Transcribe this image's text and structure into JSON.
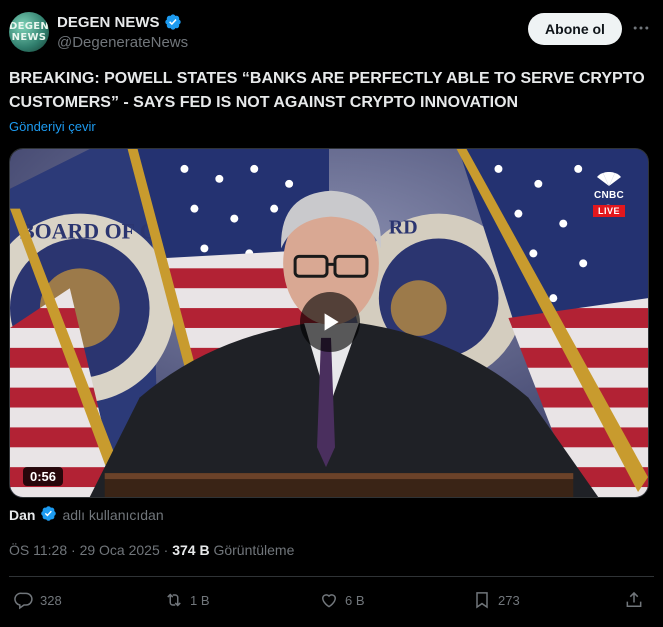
{
  "account": {
    "avatar_text": "DEGEN NEWS",
    "name": "DEGEN NEWS",
    "handle": "@DegenerateNews",
    "verified": true
  },
  "header": {
    "follow_label": "Abone ol",
    "more_icon": "more-horizontal-icon"
  },
  "tweet": {
    "text": "BREAKING: POWELL STATES “BANKS ARE PERFECTLY ABLE TO SERVE CRYPTO CUSTOMERS” - SAYS FED IS NOT AGAINST CRYPTO INNOVATION",
    "translate_label": "Gönderiyi çevir"
  },
  "media": {
    "duration": "0:56",
    "channel_logo_text": "CNBC",
    "live_badge": "LIVE",
    "seal_text_left": "BOARD OF GOVERNORS",
    "seal_text_right": "RD OF GOVE"
  },
  "source": {
    "name": "Dan",
    "suffix": "adlı kullanıcıdan"
  },
  "meta": {
    "time": "ÖS 11:28",
    "separator": " · ",
    "date": "29 Oca 2025",
    "views_count": "374 B",
    "views_label": "Görüntüleme"
  },
  "actions": {
    "replies": "328",
    "reposts": "1 B",
    "likes": "6 B",
    "bookmarks": "273"
  },
  "colors": {
    "background": "#000000",
    "text": "#e7e9ea",
    "muted": "#71767b",
    "link": "#1d9bf0",
    "verified": "#1d9bf0",
    "live_red": "#e2171d"
  }
}
